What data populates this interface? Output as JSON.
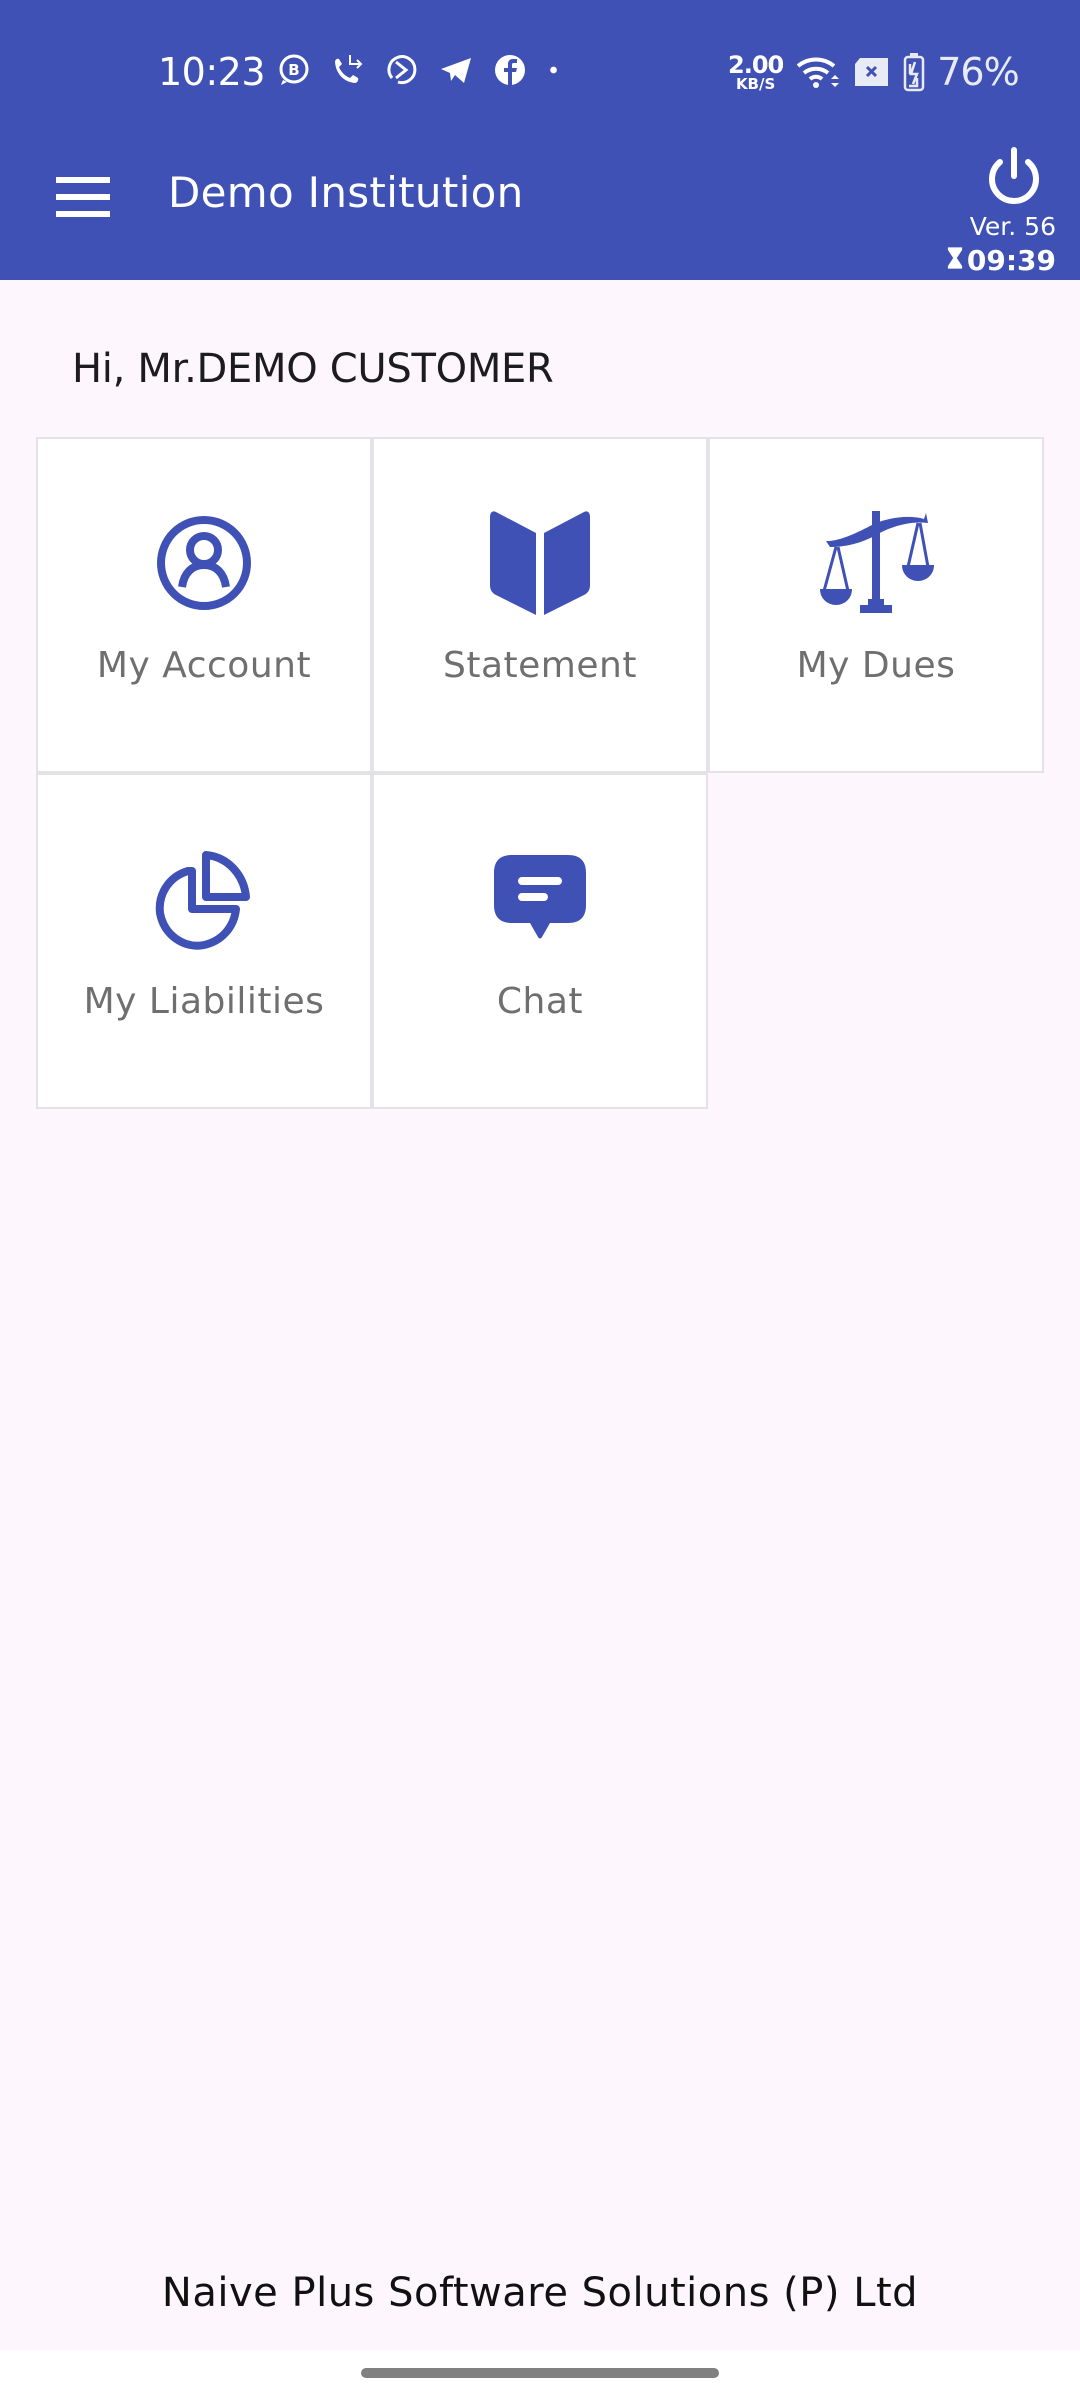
{
  "status_bar": {
    "time": "10:23",
    "notification_icons": [
      "whatsapp-business-icon",
      "missed-call-icon",
      "app-circle-icon",
      "telegram-icon",
      "facebook-icon",
      "more-dot-icon"
    ],
    "network_speed_value": "2.00",
    "network_speed_unit": "KB/S",
    "wifi_icon": "wifi-icon",
    "sim_icon": "no-sim-icon",
    "battery_icon": "battery-charging-icon",
    "battery_percent": "76%"
  },
  "toolbar": {
    "menu_icon": "hamburger-menu-icon",
    "title": "Demo Institution",
    "power_icon": "power-icon",
    "version": "Ver. 56",
    "timer_icon": "hourglass-icon",
    "timer": "09:39"
  },
  "greeting": "Hi, Mr.DEMO CUSTOMER",
  "tiles": [
    {
      "label": "My Account",
      "icon": "account-circle-icon"
    },
    {
      "label": "Statement",
      "icon": "open-book-icon"
    },
    {
      "label": "My Dues",
      "icon": "balance-scale-icon"
    },
    {
      "label": "My Liabilities",
      "icon": "pie-chart-icon"
    },
    {
      "label": "Chat",
      "icon": "chat-bubble-icon"
    }
  ],
  "footer": "Naive Plus Software Solutions (P) Ltd",
  "colors": {
    "primary": "#3f51b5",
    "background": "#fdf7fd",
    "tile_background": "#ffffff",
    "tile_border": "#e4e2e6",
    "tile_label": "#6f6f6f"
  }
}
